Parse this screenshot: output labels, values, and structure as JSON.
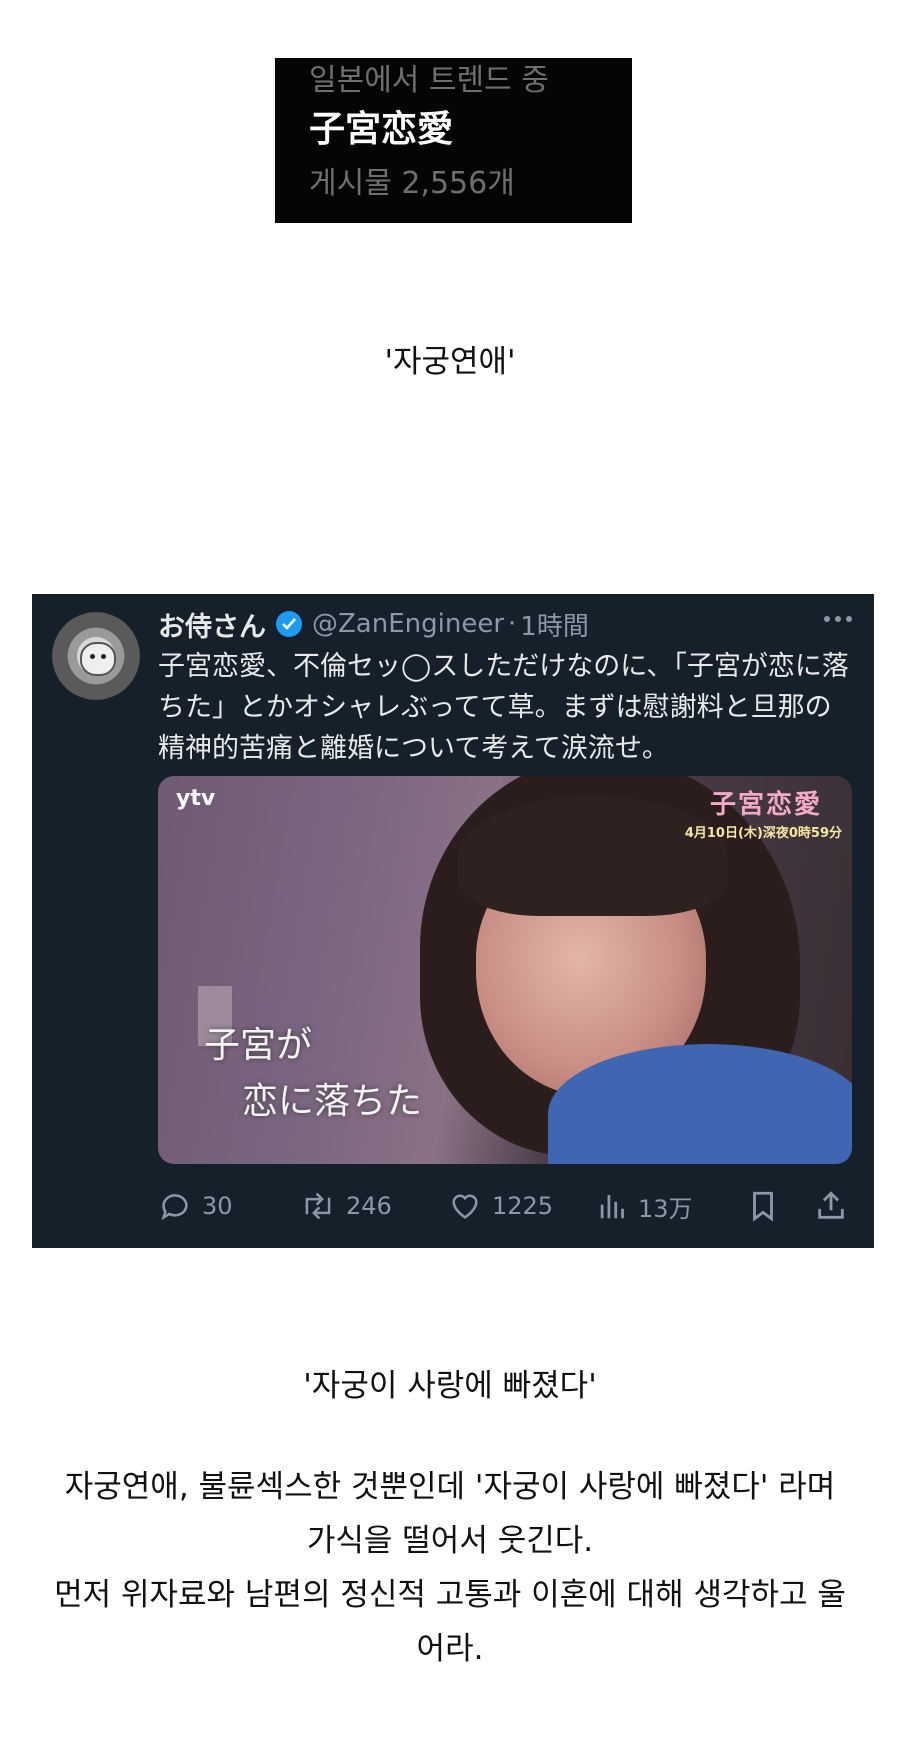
{
  "trend": {
    "label": "일본에서 트렌드 중",
    "title": "子宮恋愛",
    "count": "게시물 2,556개"
  },
  "caption1": "'자궁연애'",
  "tweet": {
    "name": "お侍さん",
    "handle": "@ZanEngineer",
    "separator": "·",
    "time": "1時間",
    "body": "子宮恋愛、不倫セッ◯スしただけなのに、「子宮が恋に落ちた」とかオシャレぶってて草。まずは慰謝料と旦那の精神的苦痛と離婚について考えて涙流せ。",
    "media": {
      "channel": "ytv",
      "show_title": "子宮恋愛",
      "show_date": "4月10日(木)深夜0時59分",
      "subtitle_line1": "子宮が",
      "subtitle_line2": "恋に落ちた"
    },
    "actions": {
      "replies": "30",
      "retweets": "246",
      "likes": "1225",
      "views": "13万"
    }
  },
  "caption2": "'자궁이 사랑에 빠졌다'",
  "paragraph": [
    "자궁연애, 불륜섹스한 것뿐인데 '자궁이 사랑에 빠졌다' 라며",
    "가식을 떨어서 웃긴다.",
    "먼저 위자료와 남편의 정신적 고통과 이혼에 대해 생각하고 울",
    "어라."
  ]
}
